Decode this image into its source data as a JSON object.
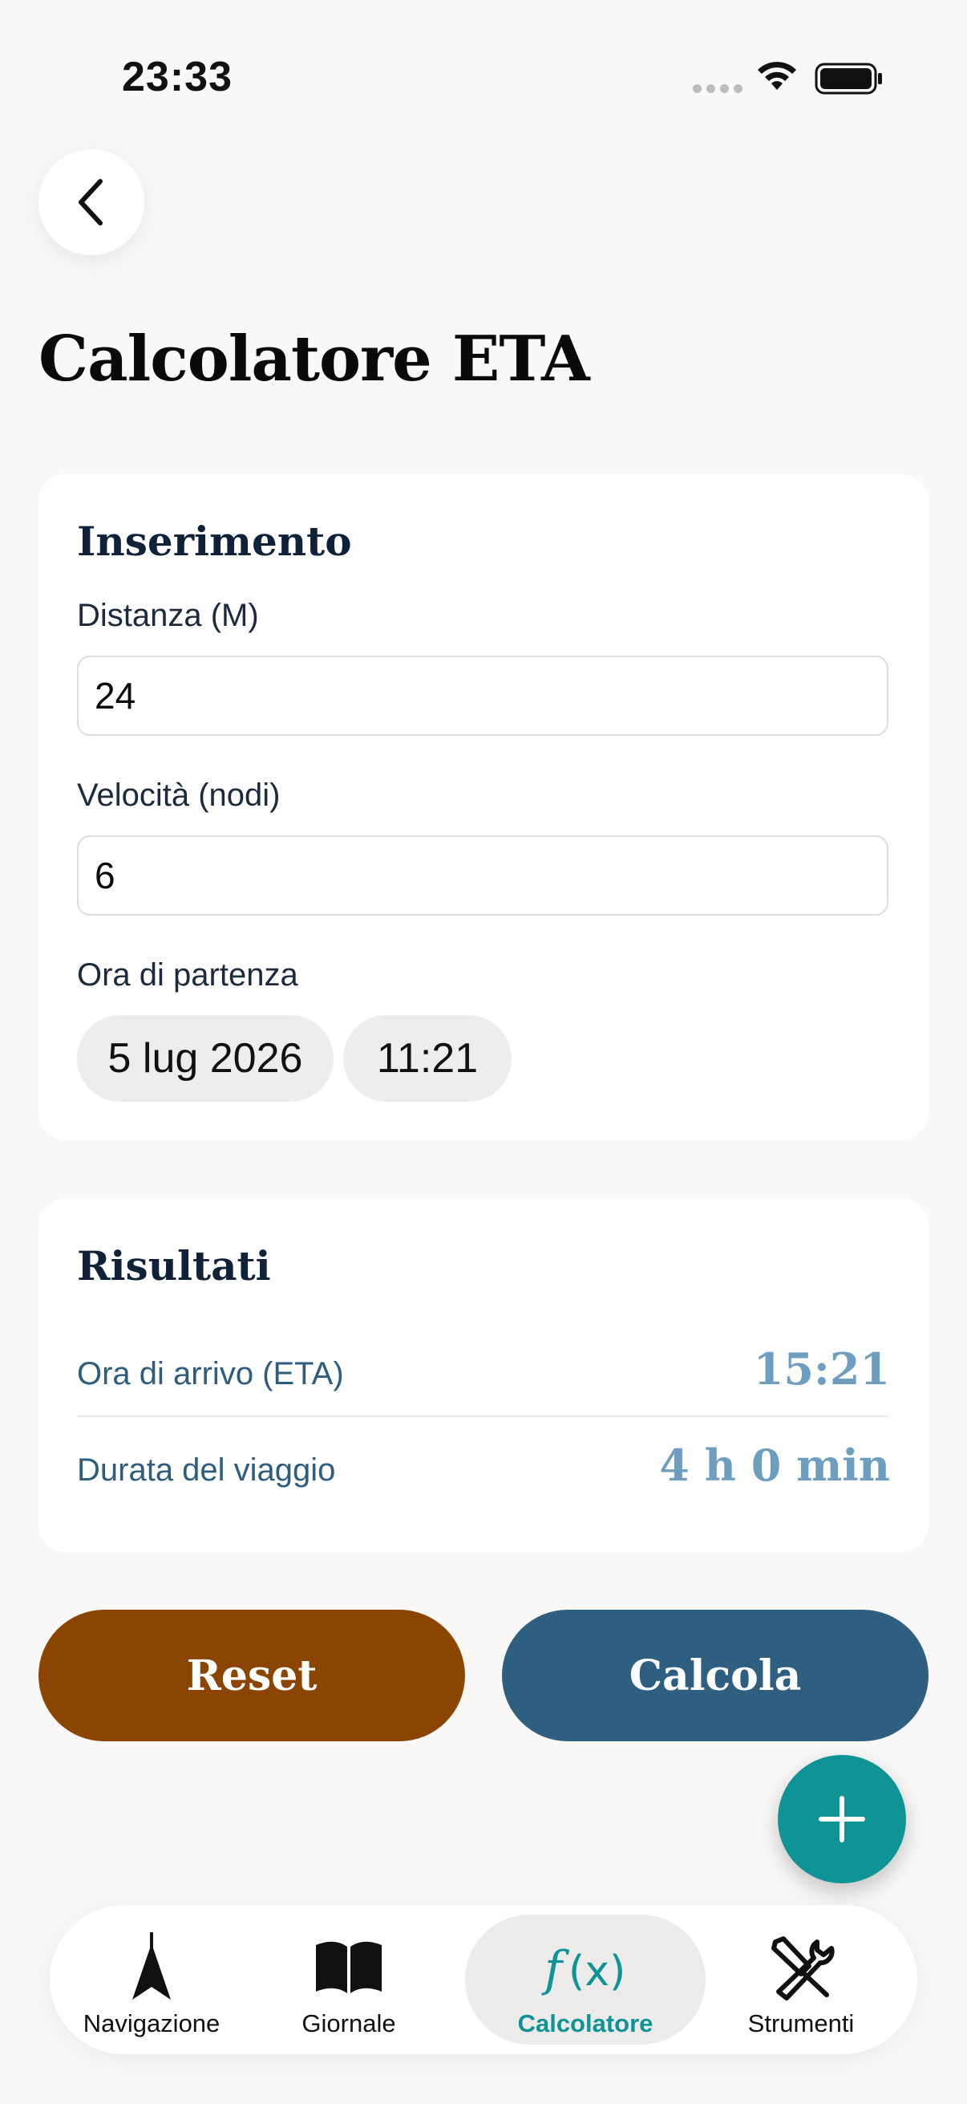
{
  "status_bar": {
    "time": "23:33"
  },
  "header": {
    "title": "Calcolatore ETA"
  },
  "input_card": {
    "title": "Inserimento",
    "distance_label": "Distanza (M)",
    "distance_value": "24",
    "speed_label": "Velocità (nodi)",
    "speed_value": "6",
    "departure_label": "Ora di partenza",
    "departure_date": "5 lug 2026",
    "departure_time": "11:21"
  },
  "results_card": {
    "title": "Risultati",
    "eta_label": "Ora di arrivo (ETA)",
    "eta_value": "15:21",
    "duration_label": "Durata del viaggio",
    "duration_value": "4 h 0 min"
  },
  "actions": {
    "reset_label": "Reset",
    "calculate_label": "Calcola"
  },
  "colors": {
    "reset": "#8B4500",
    "calculate": "#2E5F80",
    "accent": "#0E9496"
  },
  "tabs": [
    {
      "label": "Navigazione",
      "icon": "compass-needle-icon"
    },
    {
      "label": "Giornale",
      "icon": "book-icon"
    },
    {
      "label": "Calcolatore",
      "icon": "function-icon",
      "active": true
    },
    {
      "label": "Strumenti",
      "icon": "tools-icon"
    }
  ]
}
